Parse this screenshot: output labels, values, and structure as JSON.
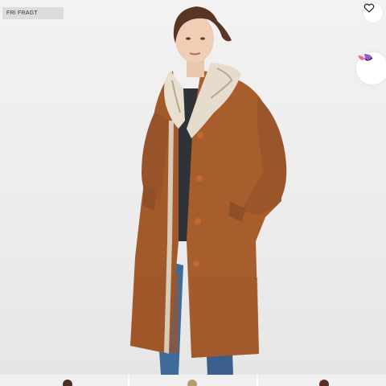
{
  "badge": {
    "label": "FRI FRAGT"
  },
  "favorite": {
    "icon": "heart-outline-icon"
  },
  "brand": {
    "icon": "brand-logo-icon",
    "colors": [
      "#ef6a9a",
      "#9b59d0",
      "#3b2f6b"
    ]
  },
  "product_image": {
    "subject": "woman-wearing-shearling-coat",
    "coat_color": "#a35a2b",
    "collar_color": "#e6dccd"
  },
  "thumbnails": {
    "count": 3,
    "items": [
      {
        "hair": "#4a2e22"
      },
      {
        "hair": "#b89a70"
      },
      {
        "hair": "#5a2e20"
      }
    ]
  }
}
